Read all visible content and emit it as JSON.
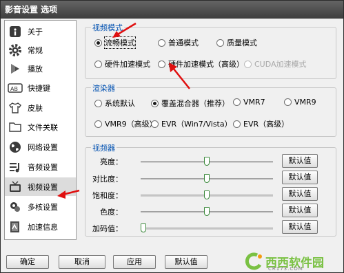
{
  "window": {
    "title": "影音设置 选项"
  },
  "sidebar": {
    "items": [
      {
        "label": "关于",
        "icon": "info-icon"
      },
      {
        "label": "常规",
        "icon": "gear-icon"
      },
      {
        "label": "播放",
        "icon": "play-icon"
      },
      {
        "label": "快捷键",
        "icon": "keyboard-icon"
      },
      {
        "label": "皮肤",
        "icon": "shirt-icon"
      },
      {
        "label": "文件关联",
        "icon": "folder-icon"
      },
      {
        "label": "网络设置",
        "icon": "globe-icon"
      },
      {
        "label": "音频设置",
        "icon": "audio-icon"
      },
      {
        "label": "视频设置",
        "icon": "tv-icon",
        "active": true
      },
      {
        "label": "多核设置",
        "icon": "cpu-icon"
      },
      {
        "label": "加速信息",
        "icon": "speed-icon"
      }
    ]
  },
  "video_mode": {
    "title": "视频模式",
    "options": [
      "流畅模式",
      "普通模式",
      "质量模式",
      "硬件加速模式",
      "硬件加速模式（高级）",
      "CUDA加速模式"
    ],
    "selected": "流畅模式"
  },
  "renderer": {
    "title": "渲染器",
    "options": [
      "系统默认",
      "覆盖混合器（推荐）",
      "VMR7",
      "VMR9",
      "VMR9（高级）",
      "EVR（Win7/Vista）",
      "EVR（高级）"
    ],
    "selected": "覆盖混合器（推荐）"
  },
  "video": {
    "title": "视频器",
    "rows": [
      {
        "label": "亮度：",
        "value_fraction": 0.5,
        "button": "默认值"
      },
      {
        "label": "对比度：",
        "value_fraction": 0.5,
        "button": "默认值"
      },
      {
        "label": "饱和度：",
        "value_fraction": 0.5,
        "button": "默认值"
      },
      {
        "label": "色度：",
        "value_fraction": 0.5,
        "button": "默认值"
      },
      {
        "label": "加码值：",
        "value_fraction": 0.0,
        "button": "默认值"
      }
    ]
  },
  "buttons": {
    "ok": "确定",
    "cancel": "取消",
    "apply": "应用",
    "default": "默认值"
  },
  "watermark": {
    "text": "西西软件园",
    "sub": "CR173.COM"
  },
  "colors": {
    "group_title": "#0050b0",
    "arrow": "#e01010",
    "titlebar": "#4a4a4a",
    "slider_thumb": "#3c8a3c"
  }
}
